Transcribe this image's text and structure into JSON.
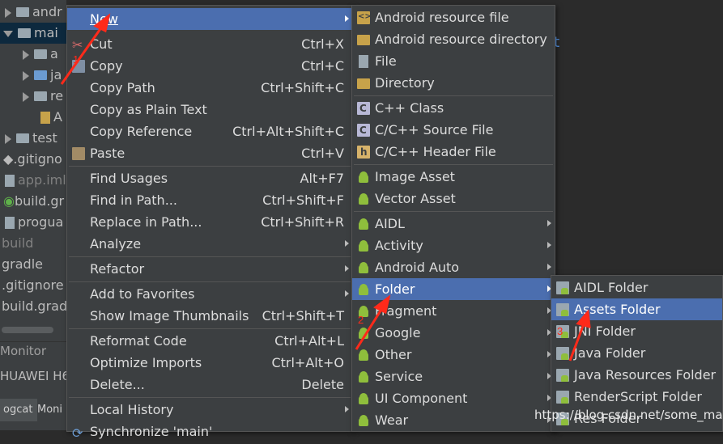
{
  "project_tree": {
    "rows": [
      {
        "label": "androidTest",
        "indent": "arrow-right",
        "icon": "folder-icon"
      },
      {
        "label": "main",
        "indent": "arrow-down",
        "icon": "folder-icon"
      },
      {
        "label": "assets",
        "indent": "arrow-right",
        "icon": "folder-icon"
      },
      {
        "label": "java",
        "indent": "arrow-right",
        "icon": "folder-icon"
      },
      {
        "label": "res",
        "indent": "arrow-right",
        "icon": "folder-icon"
      },
      {
        "label": "AndroidManifest.xml",
        "indent": "",
        "icon": "xml-icon"
      },
      {
        "label": "test",
        "indent": "arrow-right",
        "icon": "folder-icon"
      },
      {
        "label": ".gitignore",
        "indent": "",
        "icon": "git-icon"
      },
      {
        "label": "app.iml",
        "indent": "",
        "icon": "file-icon"
      },
      {
        "label": "build.gradle",
        "indent": "",
        "icon": "gradle-icon"
      },
      {
        "label": "proguard-rules.pro",
        "indent": "",
        "icon": "file-icon"
      },
      {
        "label": "build",
        "indent": "",
        "icon": ""
      },
      {
        "label": "gradle",
        "indent": "",
        "icon": ""
      },
      {
        "label": ".gitignore",
        "indent": "",
        "icon": ""
      },
      {
        "label": "build.gradle",
        "indent": "",
        "icon": ""
      }
    ],
    "tree_visible_text": [
      "andr",
      "mai",
      "a",
      "ja",
      "re",
      "A",
      "test",
      ".gitigno",
      "app.iml",
      "build.gr",
      "progua",
      "build",
      "gradle",
      ".gitignore",
      "build.gradl"
    ]
  },
  "panels": {
    "monitor_label": "Monitor",
    "device_label": "HUAWEI H6",
    "logcat_tab": "ogcat",
    "monitors_tab": "Moni"
  },
  "editor": {
    "fragment_text": "t"
  },
  "context_menu": {
    "items": [
      {
        "label": "New",
        "shortcut": "",
        "submenu": true,
        "highlighted": true,
        "icon": ""
      },
      {
        "label": "Cut",
        "shortcut": "Ctrl+X",
        "icon": "cut-icon"
      },
      {
        "label": "Copy",
        "shortcut": "Ctrl+C",
        "icon": "copy-icon"
      },
      {
        "label": "Copy Path",
        "shortcut": "Ctrl+Shift+C",
        "icon": ""
      },
      {
        "label": "Copy as Plain Text",
        "shortcut": "",
        "icon": ""
      },
      {
        "label": "Copy Reference",
        "shortcut": "Ctrl+Alt+Shift+C",
        "icon": ""
      },
      {
        "label": "Paste",
        "shortcut": "Ctrl+V",
        "icon": "paste-icon"
      },
      {
        "label": "Find Usages",
        "shortcut": "Alt+F7",
        "icon": ""
      },
      {
        "label": "Find in Path...",
        "shortcut": "Ctrl+Shift+F",
        "icon": ""
      },
      {
        "label": "Replace in Path...",
        "shortcut": "Ctrl+Shift+R",
        "icon": ""
      },
      {
        "label": "Analyze",
        "shortcut": "",
        "submenu": true,
        "icon": ""
      },
      {
        "label": "Refactor",
        "shortcut": "",
        "submenu": true,
        "icon": ""
      },
      {
        "label": "Add to Favorites",
        "shortcut": "",
        "submenu": true,
        "icon": ""
      },
      {
        "label": "Show Image Thumbnails",
        "shortcut": "Ctrl+Shift+T",
        "icon": ""
      },
      {
        "label": "Reformat Code",
        "shortcut": "Ctrl+Alt+L",
        "icon": ""
      },
      {
        "label": "Optimize Imports",
        "shortcut": "Ctrl+Alt+O",
        "icon": ""
      },
      {
        "label": "Delete...",
        "shortcut": "Delete",
        "icon": ""
      },
      {
        "label": "Local History",
        "shortcut": "",
        "submenu": true,
        "icon": ""
      },
      {
        "label": "Synchronize 'main'",
        "shortcut": "",
        "icon": "sync-icon"
      }
    ]
  },
  "new_submenu": {
    "items": [
      {
        "label": "Android resource file",
        "icon": "xml-file-icon"
      },
      {
        "label": "Android resource directory",
        "icon": "folder-icon"
      },
      {
        "label": "File",
        "icon": "file-icon"
      },
      {
        "label": "Directory",
        "icon": "folder-icon"
      },
      {
        "label": "C++ Class",
        "icon": "cpp-class-icon"
      },
      {
        "label": "C/C++ Source File",
        "icon": "cpp-source-icon"
      },
      {
        "label": "C/C++ Header File",
        "icon": "cpp-header-icon"
      },
      {
        "label": "Image Asset",
        "icon": "android-icon"
      },
      {
        "label": "Vector Asset",
        "icon": "android-icon"
      },
      {
        "label": "AIDL",
        "icon": "android-icon",
        "submenu": true
      },
      {
        "label": "Activity",
        "icon": "android-icon",
        "submenu": true
      },
      {
        "label": "Android Auto",
        "icon": "android-icon",
        "submenu": true
      },
      {
        "label": "Folder",
        "icon": "android-icon",
        "submenu": true,
        "highlighted": true
      },
      {
        "label": "Fragment",
        "icon": "android-icon",
        "submenu": true
      },
      {
        "label": "Google",
        "icon": "android-icon",
        "submenu": true
      },
      {
        "label": "Other",
        "icon": "android-icon",
        "submenu": true
      },
      {
        "label": "Service",
        "icon": "android-icon",
        "submenu": true
      },
      {
        "label": "UI Component",
        "icon": "android-icon",
        "submenu": true
      },
      {
        "label": "Wear",
        "icon": "android-icon",
        "submenu": true
      }
    ]
  },
  "folder_submenu": {
    "items": [
      {
        "label": "AIDL Folder",
        "icon": "android-folder-icon"
      },
      {
        "label": "Assets Folder",
        "icon": "android-folder-icon",
        "highlighted": true
      },
      {
        "label": "JNI Folder",
        "icon": "android-folder-icon"
      },
      {
        "label": "Java Folder",
        "icon": "android-folder-icon"
      },
      {
        "label": "Java Resources Folder",
        "icon": "android-folder-icon"
      },
      {
        "label": "RenderScript Folder",
        "icon": "android-folder-icon"
      },
      {
        "label": "Res Folder",
        "icon": "android-folder-icon"
      }
    ]
  },
  "annotations": {
    "step_numbers": [
      "1",
      "2",
      "3"
    ],
    "arrow_color": "#ff2a1a",
    "watermark": "https://blog.csdn.net/some_man"
  },
  "colors": {
    "menu_bg": "#3c3f41",
    "highlight": "#4b6eaf",
    "android_green": "#8fbe3c"
  }
}
